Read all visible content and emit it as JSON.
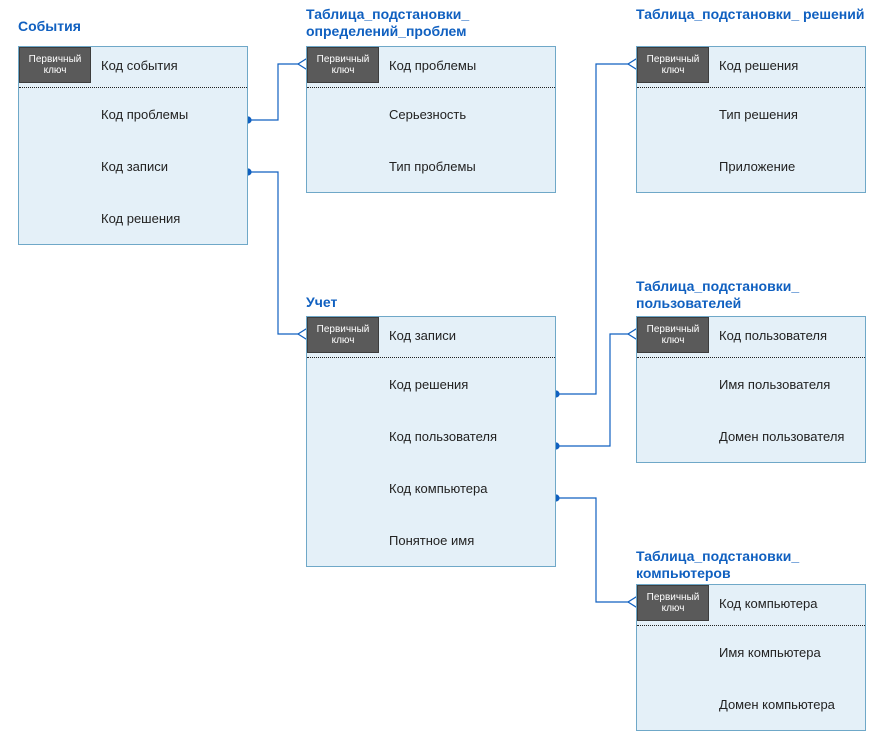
{
  "diagram": {
    "pk_label": "Первичный ключ",
    "colors": {
      "link": "#1060c0",
      "table_bg": "#e4f0f8",
      "table_border": "#6fa8c8",
      "badge_bg": "#5a5a5a"
    }
  },
  "tables": {
    "events": {
      "title": "События",
      "pk": "Код события",
      "fields": [
        "Код проблемы",
        "Код записи",
        "Код решения"
      ]
    },
    "problems": {
      "title": "Таблица_подстановки_ определений_проблем",
      "pk": "Код проблемы",
      "fields": [
        "Серьезность",
        "Тип проблемы"
      ]
    },
    "solutions": {
      "title": "Таблица_подстановки_ решений",
      "pk": "Код решения",
      "fields": [
        "Тип решения",
        "Приложение"
      ]
    },
    "accounting": {
      "title": "Учет",
      "pk": "Код записи",
      "fields": [
        "Код решения",
        "Код пользователя",
        "Код компьютера",
        "Понятное имя"
      ]
    },
    "users": {
      "title": "Таблица_подстановки_ пользователей",
      "pk": "Код пользователя",
      "fields": [
        "Имя пользователя",
        "Домен пользователя"
      ]
    },
    "computers": {
      "title": "Таблица_подстановки_ компьютеров",
      "pk": "Код компьютера",
      "fields": [
        "Имя компьютера",
        "Домен компьютера"
      ]
    }
  }
}
